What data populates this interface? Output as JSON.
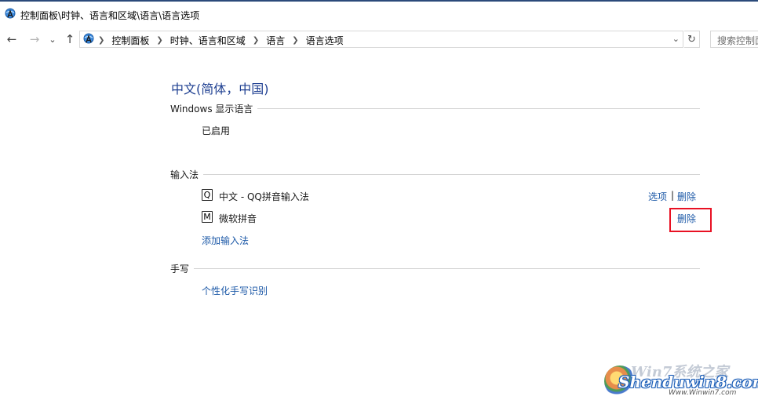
{
  "window": {
    "title": "控制面板\\时钟、语言和区域\\语言\\语言选项"
  },
  "nav": {
    "back_icon": "←",
    "forward_icon": "→",
    "recent_icon": "⌄",
    "up_icon": "↑",
    "breadcrumbs": [
      "控制面板",
      "时钟、语言和区域",
      "语言",
      "语言选项"
    ],
    "dropdown_icon": "⌄",
    "refresh_icon": "↻",
    "search_placeholder": "搜索控制面板"
  },
  "page": {
    "language_title": "中文(简体，中国)",
    "display_section_label": "Windows 显示语言",
    "display_status": "已启用",
    "input_section_label": "输入法",
    "input_methods": [
      {
        "icon_letter": "Q",
        "name": "中文 - QQ拼音输入法",
        "options_label": "选项",
        "separator": "|",
        "remove_label": "删除"
      },
      {
        "icon_letter": "M",
        "name": "微软拼音",
        "remove_label": "删除"
      }
    ],
    "add_input_label": "添加输入法",
    "handwriting_section_label": "手写",
    "handwriting_link": "个性化手写识别"
  },
  "watermark": {
    "line1": "Win7系统之家",
    "line2": "Shenduwin8.com",
    "line3": "Www.Winwin7.com"
  },
  "colors": {
    "link": "#1e5aa8",
    "title": "#1e3f91",
    "highlight": "#e81123"
  }
}
